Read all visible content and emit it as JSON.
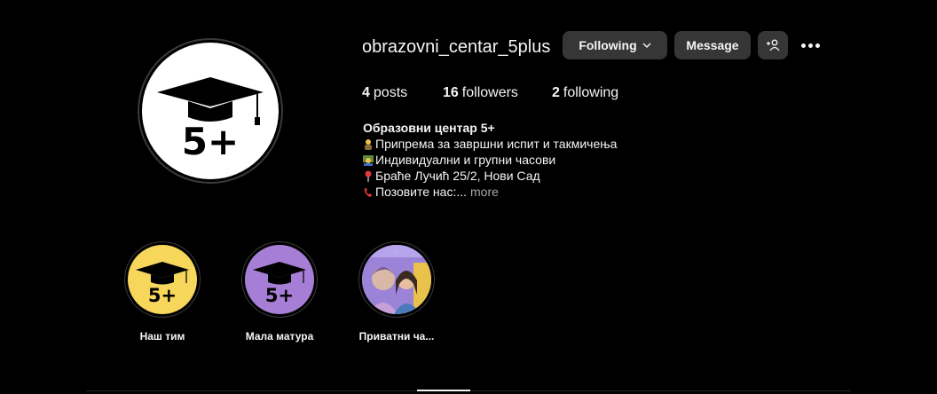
{
  "profile": {
    "username": "obrazovni_centar_5plus",
    "avatar_text": "5+"
  },
  "actions": {
    "following_label": "Following",
    "message_label": "Message"
  },
  "stats": {
    "posts_count": "4",
    "posts_label": "posts",
    "followers_count": "16",
    "followers_label": "followers",
    "following_count": "2",
    "following_label": "following"
  },
  "bio": {
    "name": "Образовни центар 5+",
    "lines": [
      "Припрема за завршни испит и такмичења",
      "Индивидуални и групни часови",
      "Браће Лучић 25/2, Нови Сад",
      "Позовите нас:..."
    ],
    "more_label": "more"
  },
  "highlights": [
    {
      "label": "Наш тим",
      "badge": "5+",
      "bg": "#f7d65c"
    },
    {
      "label": "Мала матура",
      "badge": "5+",
      "bg": "#a77ed6"
    },
    {
      "label": "Приватни ча...",
      "overlay_text": "…"
    }
  ],
  "colors": {
    "background": "#000000",
    "button": "#363636",
    "text": "#f5f5f5",
    "muted": "#a8a8a8"
  }
}
